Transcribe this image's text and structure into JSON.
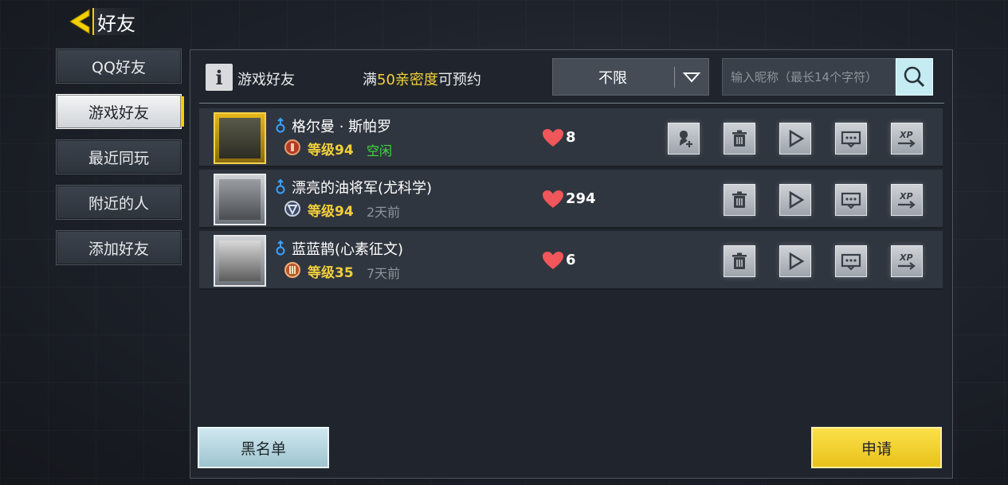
{
  "header": {
    "title": "好友"
  },
  "sidebar": {
    "items": [
      {
        "label": "QQ好友"
      },
      {
        "label": "游戏好友"
      },
      {
        "label": "最近同玩"
      },
      {
        "label": "附近的人"
      },
      {
        "label": "添加好友"
      }
    ],
    "active_index": 1
  },
  "panel": {
    "title": "游戏好友",
    "condition_prefix": "满",
    "condition_highlight": "50亲密度",
    "condition_suffix": "可预约"
  },
  "filter": {
    "selected": "不限"
  },
  "search": {
    "placeholder": "输入昵称（最长14个字符）"
  },
  "friends": [
    {
      "name": "格尔曼 · 斯帕罗",
      "level": "等级94",
      "status": "空闲",
      "status_color": "#3fdc3f",
      "intimacy": "8",
      "frame": "gold",
      "has_invite": true
    },
    {
      "name": "漂亮的油将军(尤科学)",
      "level": "等级94",
      "status": "2天前",
      "status_color": "#8c939b",
      "intimacy": "294",
      "frame": "silver",
      "has_invite": false
    },
    {
      "name": "蓝蓝鹊(心素征文)",
      "level": "等级35",
      "status": "7天前",
      "status_color": "#8c939b",
      "intimacy": "6",
      "frame": "silver",
      "has_invite": false
    }
  ],
  "buttons": {
    "blacklist": "黑名单",
    "apply": "申请"
  },
  "colors": {
    "accent_yellow": "#f2d000",
    "highlight_text": "#f3d03a",
    "online_green": "#3fdc3f",
    "heart_red": "#f0565a"
  }
}
